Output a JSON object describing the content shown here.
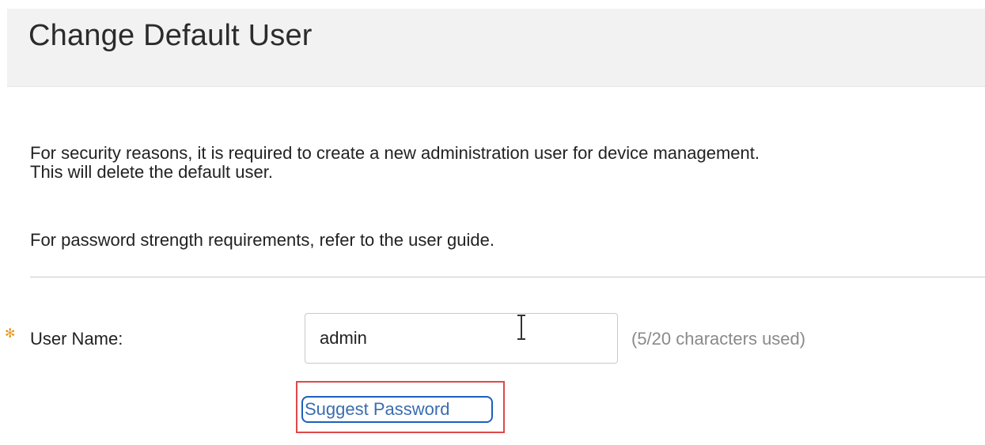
{
  "header": {
    "title": "Change Default User"
  },
  "intro": {
    "line1": "For security reasons, it is required to create a new administration user for device management.",
    "line2": "This will delete the default user.",
    "password_note": "For password strength requirements, refer to the user guide."
  },
  "form": {
    "username": {
      "label": "User Name:",
      "value": "admin",
      "char_count": "(5/20 characters used)",
      "required_icon": "required-asterisk-icon"
    },
    "suggest_password_label": "Suggest Password"
  },
  "colors": {
    "required": "#e8951a",
    "link": "#3a6db0",
    "focus_border": "#1d5fbf",
    "highlight": "#e0474c",
    "header_bg": "#f2f2f2"
  }
}
